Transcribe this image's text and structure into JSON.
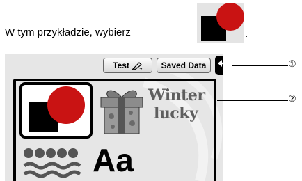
{
  "instruction": {
    "text": "W tym przykładzie, wybierz",
    "end": "."
  },
  "toolbar": {
    "test_label": "Test",
    "saved_label": "Saved Data"
  },
  "patterns": [
    {
      "name": "square-circle",
      "selected": true
    },
    {
      "name": "gift-box",
      "selected": false
    },
    {
      "name": "winter-lucky",
      "line1": "Winter",
      "line2": "lucky",
      "selected": false
    },
    {
      "name": "waves",
      "selected": false
    },
    {
      "name": "letters-aa",
      "text": "Aa",
      "selected": false
    }
  ],
  "callouts": {
    "one": "①",
    "two": "②"
  },
  "colors": {
    "square": "#000000",
    "circle": "#c91313",
    "background": "#e6e6e6"
  }
}
